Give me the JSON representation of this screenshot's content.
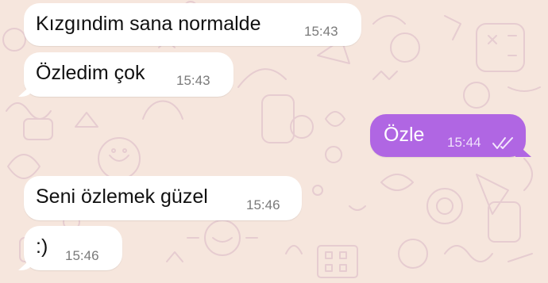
{
  "colors": {
    "wallpaper": "#f6e6dd",
    "doodle": "#e8cfd2",
    "incoming_bubble": "#ffffff",
    "outgoing_bubble": "#b066e3"
  },
  "messages": [
    {
      "direction": "incoming",
      "text": "Kızgındim sana normalde",
      "time": "15:43"
    },
    {
      "direction": "incoming",
      "text": "Özledim çok",
      "time": "15:43"
    },
    {
      "direction": "outgoing",
      "text": "Özle",
      "time": "15:44",
      "status_icon": "double-check-read-icon"
    },
    {
      "direction": "incoming",
      "text": "Seni özlemek güzel",
      "time": "15:46"
    },
    {
      "direction": "incoming",
      "text": ":)",
      "time": "15:46"
    }
  ]
}
